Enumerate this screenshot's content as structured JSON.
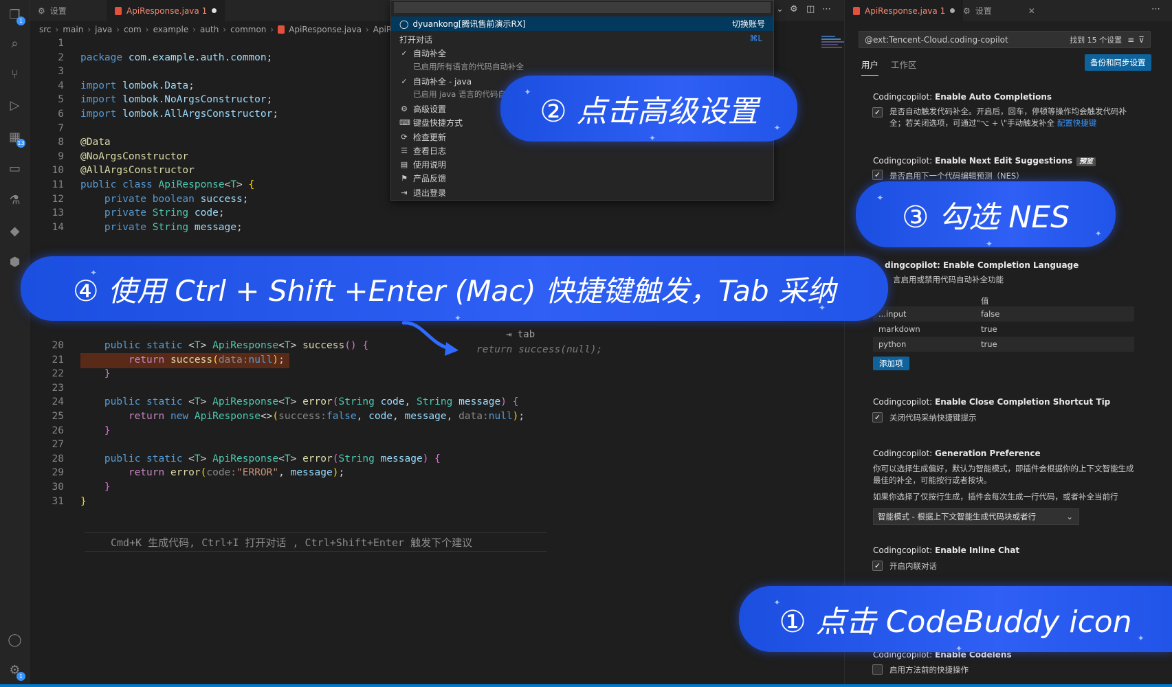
{
  "left_tabs": [
    {
      "label": "设置",
      "icon": "settings-icon"
    },
    {
      "label": "ApiResponse.java 1",
      "icon": "java-file-icon",
      "modified": true
    }
  ],
  "breadcrumb": [
    "src",
    "main",
    "java",
    "com",
    "example",
    "auth",
    "common",
    "ApiResponse.java",
    "ApiRes"
  ],
  "code_lines": [
    {
      "n": "1",
      "html": ""
    },
    {
      "n": "2",
      "html": "<span class='kw'>package</span> <span class='pm'>com.example.auth.common</span>;"
    },
    {
      "n": "3",
      "html": ""
    },
    {
      "n": "4",
      "html": "<span class='kw'>import</span> <span class='pm'>lombok.Data</span>;"
    },
    {
      "n": "5",
      "html": "<span class='kw'>import</span> <span class='pm'>lombok.NoArgsConstructor</span>;"
    },
    {
      "n": "6",
      "html": "<span class='kw'>import</span> <span class='pm'>lombok.AllArgsConstructor</span>;"
    },
    {
      "n": "7",
      "html": ""
    },
    {
      "n": "8",
      "html": "<span class='an'>@Data</span>"
    },
    {
      "n": "9",
      "html": "<span class='an'>@NoArgsConstructor</span>"
    },
    {
      "n": "10",
      "html": "<span class='an'>@AllArgsConstructor</span>"
    },
    {
      "n": "11",
      "html": "<span class='kw'>public</span> <span class='kw'>class</span> <span class='ty'>ApiResponse</span>&lt;<span class='ty'>T</span>&gt; <span class='br1'>{</span>"
    },
    {
      "n": "12",
      "html": "    <span class='kw'>private</span> <span class='kw'>boolean</span> <span class='pm'>success</span>;"
    },
    {
      "n": "13",
      "html": "    <span class='kw'>private</span> <span class='ty'>String</span> <span class='pm'>code</span>;"
    },
    {
      "n": "14",
      "html": "    <span class='kw'>private</span> <span class='ty'>String</span> <span class='pm'>message</span>;"
    },
    {
      "n": "20",
      "html": "    <span class='kw'>public</span> <span class='kw'>static</span> &lt;<span class='ty'>T</span>&gt; <span class='ty'>ApiResponse</span>&lt;<span class='ty'>T</span>&gt; <span class='fn'>success</span><span class='br2'>()</span> <span class='br2'>{</span>"
    },
    {
      "n": "21",
      "html": "        <span class='kw2'>return</span> <span class='fn'>success</span><span class='br1'>(</span><span class='hint'>data:</span><span class='kw'>null</span><span class='br1'>)</span>;"
    },
    {
      "n": "22",
      "html": "    <span class='br2'>}</span>"
    },
    {
      "n": "23",
      "html": ""
    },
    {
      "n": "24",
      "html": "    <span class='kw'>public</span> <span class='kw'>static</span> &lt;<span class='ty'>T</span>&gt; <span class='ty'>ApiResponse</span>&lt;<span class='ty'>T</span>&gt; <span class='fn'>error</span><span class='br2'>(</span><span class='ty'>String</span> <span class='pm'>code</span>, <span class='ty'>String</span> <span class='pm'>message</span><span class='br2'>)</span> <span class='br2'>{</span>"
    },
    {
      "n": "25",
      "html": "        <span class='kw2'>return</span> <span class='kw'>new</span> <span class='ty'>ApiResponse</span>&lt;&gt;<span class='br1'>(</span><span class='hint'>success:</span><span class='kw'>false</span>, <span class='pm'>code</span>, <span class='pm'>message</span>, <span class='hint'>data:</span><span class='kw'>null</span><span class='br1'>)</span>;"
    },
    {
      "n": "26",
      "html": "    <span class='br2'>}</span>"
    },
    {
      "n": "27",
      "html": ""
    },
    {
      "n": "28",
      "html": "    <span class='kw'>public</span> <span class='kw'>static</span> &lt;<span class='ty'>T</span>&gt; <span class='ty'>ApiResponse</span>&lt;<span class='ty'>T</span>&gt; <span class='fn'>error</span><span class='br2'>(</span><span class='ty'>String</span> <span class='pm'>message</span><span class='br2'>)</span> <span class='br2'>{</span>"
    },
    {
      "n": "29",
      "html": "        <span class='kw2'>return</span> <span class='fn'>error</span><span class='br1'>(</span><span class='hint'>code:</span><span class='st'>\"ERROR\"</span>, <span class='pm'>message</span><span class='br1'>)</span>;"
    },
    {
      "n": "30",
      "html": "    <span class='br2'>}</span>"
    },
    {
      "n": "31",
      "html": "<span class='br1'>}</span>"
    }
  ],
  "ghost_suggestion": "return success(null);",
  "tab_hint": "⇥ tab",
  "chat_hint": "Cmd+K 生成代码, Ctrl+I 打开对话 , Ctrl+Shift+Enter 触发下个建议",
  "menu": {
    "account": "dyuankong[腾讯售前演示RX]",
    "switch_account": "切换账号",
    "open_chat": "打开对话",
    "open_chat_kbd": "⌘L",
    "items": [
      {
        "label": "自动补全",
        "sub": "已启用所有语言的代码自动补全",
        "icon": "check-icon"
      },
      {
        "label": "自动补全 - java",
        "sub": "已启用 java 语言的代码自",
        "icon": "check-icon"
      },
      {
        "label": "高级设置",
        "icon": "gear-icon"
      },
      {
        "label": "键盘快捷方式",
        "icon": "keyboard-icon"
      },
      {
        "label": "检查更新",
        "icon": "refresh-icon"
      },
      {
        "label": "查看日志",
        "icon": "log-icon"
      },
      {
        "label": "使用说明",
        "icon": "book-icon"
      },
      {
        "label": "产品反馈",
        "icon": "feedback-icon"
      },
      {
        "label": "退出登录",
        "icon": "logout-icon"
      }
    ]
  },
  "right_tabs": [
    {
      "label": "ApiResponse.java 1",
      "icon": "java-file-icon"
    },
    {
      "label": "设置",
      "icon": "settings-icon"
    }
  ],
  "settings": {
    "search_value": "@ext:Tencent-Cloud.coding-copilot",
    "found": "找到 15 个设置",
    "scope_user": "用户",
    "scope_workspace": "工作区",
    "sync_button": "备份和同步设置",
    "auto_completions": {
      "prefix": "Codingcopilot: ",
      "title": "Enable Auto Completions",
      "desc_a": "是否自动触发代码补全。开启后，回车，停顿等操作均会触发代码补全；若关闭选项，可通过\"⌥ + \\\"手动触发补全 ",
      "desc_link": "配置快捷键"
    },
    "next_edit": {
      "prefix": "Codingcopilot: ",
      "title": "Enable Next Edit Suggestions",
      "badge": "预览",
      "label": "是否启用下一个代码编辑预测（NES）"
    },
    "completion_language": {
      "prefix": "Codingcopilot: ",
      "title": "Enable Completion Language",
      "title_visible": "dingcopilot: Enable Completion Language",
      "desc": "言启用或禁用代码自动补全功能"
    },
    "lang_table": {
      "col_value": "值",
      "rows": [
        {
          "key": "...input",
          "value": "false"
        },
        {
          "key": "markdown",
          "value": "true"
        },
        {
          "key": "python",
          "value": "true"
        }
      ]
    },
    "add_button": "添加项",
    "close_tip": {
      "prefix": "Codingcopilot: ",
      "title": "Enable Close Completion Shortcut Tip",
      "label": "关闭代码采纳快捷键提示"
    },
    "generation_pref": {
      "prefix": "Codingcopilot: ",
      "title": "Generation Preference",
      "desc1": "你可以选择生成偏好，默认为智能模式，即插件会根据你的上下文智能生成最佳的补全，可能按行或者按块。",
      "desc2": "如果你选择了仅按行生成，插件会每次生成一行代码，或者补全当前行",
      "select_value": "智能模式 - 根据上下文智能生成代码块或者行"
    },
    "inline_chat": {
      "prefix": "Codingcopilot: ",
      "title": "Enable Inline Chat",
      "label": "开启内联对话"
    },
    "codelens": {
      "prefix": "Codingcopilot: ",
      "title": "Enable Codelens",
      "label": "启用方法前的快捷操作"
    }
  },
  "callouts": {
    "step1": "① 点击 CodeBuddy icon",
    "step2": "② 点击高级设置",
    "step3": "③ 勾选 NES",
    "step4": "④ 使用 Ctrl + Shift +Enter (Mac) 快捷键触发，Tab 采纳"
  },
  "colors": {
    "callout_blue": "#2f5ff5",
    "accent": "#3794ff",
    "button": "#0e639c"
  }
}
